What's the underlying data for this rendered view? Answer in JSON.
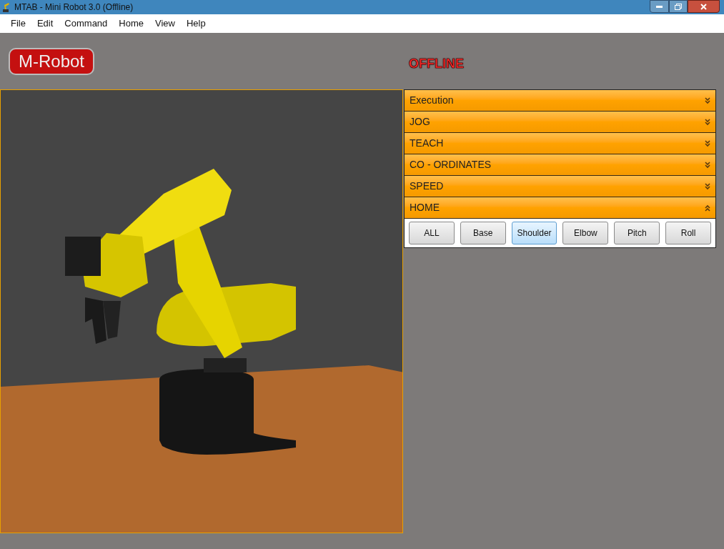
{
  "window": {
    "title": "MTAB - Mini Robot 3.0 (Offline)"
  },
  "menu": [
    "File",
    "Edit",
    "Command",
    "Home",
    "View",
    "Help"
  ],
  "logo": {
    "text": "M-Robot"
  },
  "status": "OFFLINE",
  "sections": [
    {
      "label": "Execution",
      "expanded": false
    },
    {
      "label": "JOG",
      "expanded": false
    },
    {
      "label": "TEACH",
      "expanded": false
    },
    {
      "label": "CO - ORDINATES",
      "expanded": false
    },
    {
      "label": "SPEED",
      "expanded": false
    },
    {
      "label": "HOME",
      "expanded": true,
      "buttons": [
        {
          "label": "ALL",
          "selected": false
        },
        {
          "label": "Base",
          "selected": false
        },
        {
          "label": "Shoulder",
          "selected": true
        },
        {
          "label": "Elbow",
          "selected": false
        },
        {
          "label": "Pitch",
          "selected": false
        },
        {
          "label": "Roll",
          "selected": false
        }
      ]
    }
  ]
}
